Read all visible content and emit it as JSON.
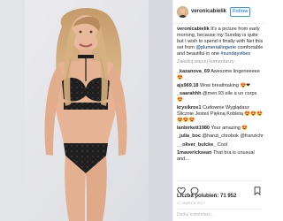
{
  "header": {
    "username": "veronicabielik",
    "follow_label": "Follow"
  },
  "caption": {
    "username": "veronicabielik",
    "text": "It's a picture from early morning, because my Sunday is quite but I wish to spend it finally with Net this set from",
    "mention": "@plumeriailingerie",
    "text_after": "comfortable and beautiful in one",
    "hashtag": "#sundayvibes"
  },
  "load_more_label": "Załaduj więcej komentarzy",
  "comments": [
    {
      "user": "_kazanova_69",
      "text": "Awesome lingerieeeee 😍"
    },
    {
      "user": "ajs969.18",
      "text": "Wow breathtaking 😍❤"
    },
    {
      "user": "_saarahhh",
      "text": "@men.93 elle a un corps 😍"
    },
    {
      "user": "krysikros1",
      "text": "Cudownie Wyglądasz Ślicznie Jesteś Piękną Kobietą 😍😍😍😍😍😍"
    },
    {
      "user": "lanbirkett1980",
      "text": "Your amazing 😍"
    },
    {
      "user": "_julia_boc",
      "text": "@hanzi_chrobok @franzichr"
    },
    {
      "user": "__oliver_bulcke_",
      "text": "Cool"
    },
    {
      "user": "1mavericksean",
      "text": "That bra is unusual and..."
    }
  ],
  "likes": "Liczba polubień: 71 952",
  "date": "17 MARCA 2017",
  "add_comment_placeholder": "Dodaj komentarz...",
  "icons": [
    "heart-icon",
    "comment-icon",
    "save-icon",
    "more-icon"
  ],
  "colors": {
    "accent": "#3897f0",
    "text": "#262626",
    "muted": "#999999"
  }
}
